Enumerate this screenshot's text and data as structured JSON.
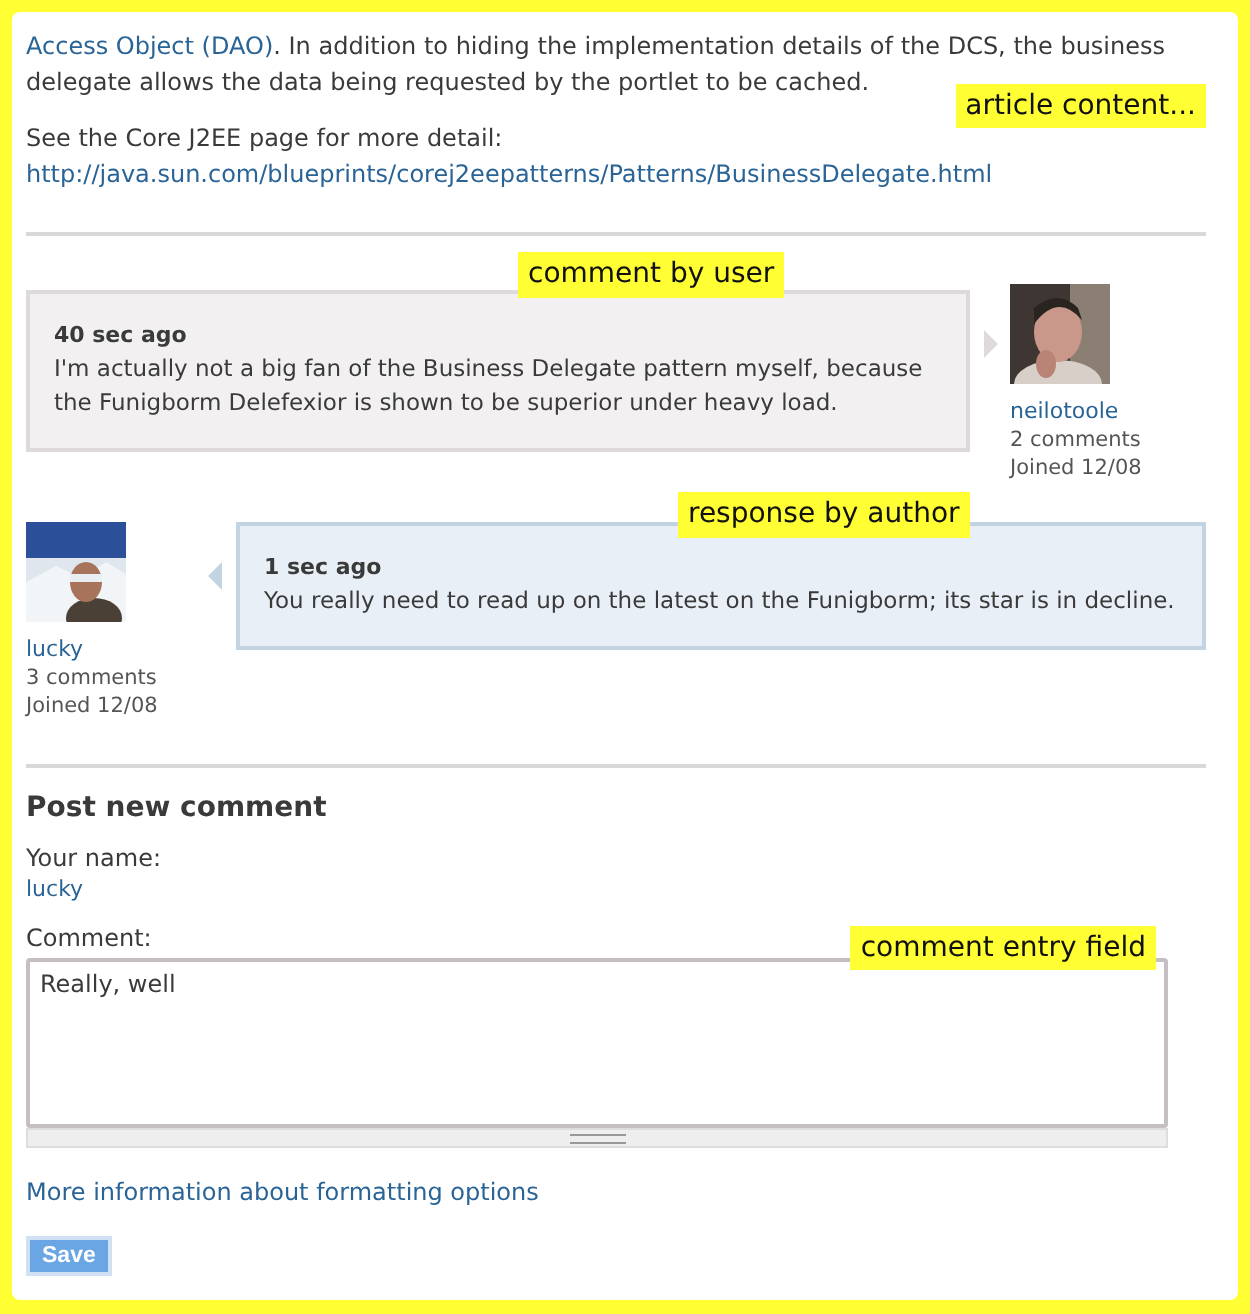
{
  "article": {
    "link": "Access Object (DAO)",
    "text": ". In addition to hiding the implementation details of the DCS, the business delegate allows the data being requested by the portlet to be cached.",
    "see_also": "See the Core J2EE page for more detail:",
    "url": "http://java.sun.com/blueprints/corej2eepatterns/Patterns/BusinessDelegate.html",
    "annotation": "article content..."
  },
  "comments": [
    {
      "kind": "user",
      "annotation": "comment by user",
      "time": "40 sec ago",
      "text": "I'm actually not a big fan of the Business Delegate pattern myself, because the Funigborm Delefexior is shown to be superior under heavy load.",
      "user": "neilotoole",
      "count": "2 comments",
      "joined": "Joined 12/08"
    },
    {
      "kind": "author",
      "annotation": "response by author",
      "time": "1 sec ago",
      "text": "You really need to read up on the latest on the Funigborm; its star is in decline.",
      "user": "lucky",
      "count": "3 comments",
      "joined": "Joined 12/08"
    }
  ],
  "form": {
    "title": "Post new comment",
    "name_label": "Your name:",
    "name_value": "lucky",
    "comment_label": "Comment:",
    "comment_value": "Really, well",
    "annotation": "comment entry field",
    "help_link": "More information about formatting options",
    "save_button": "Save"
  }
}
